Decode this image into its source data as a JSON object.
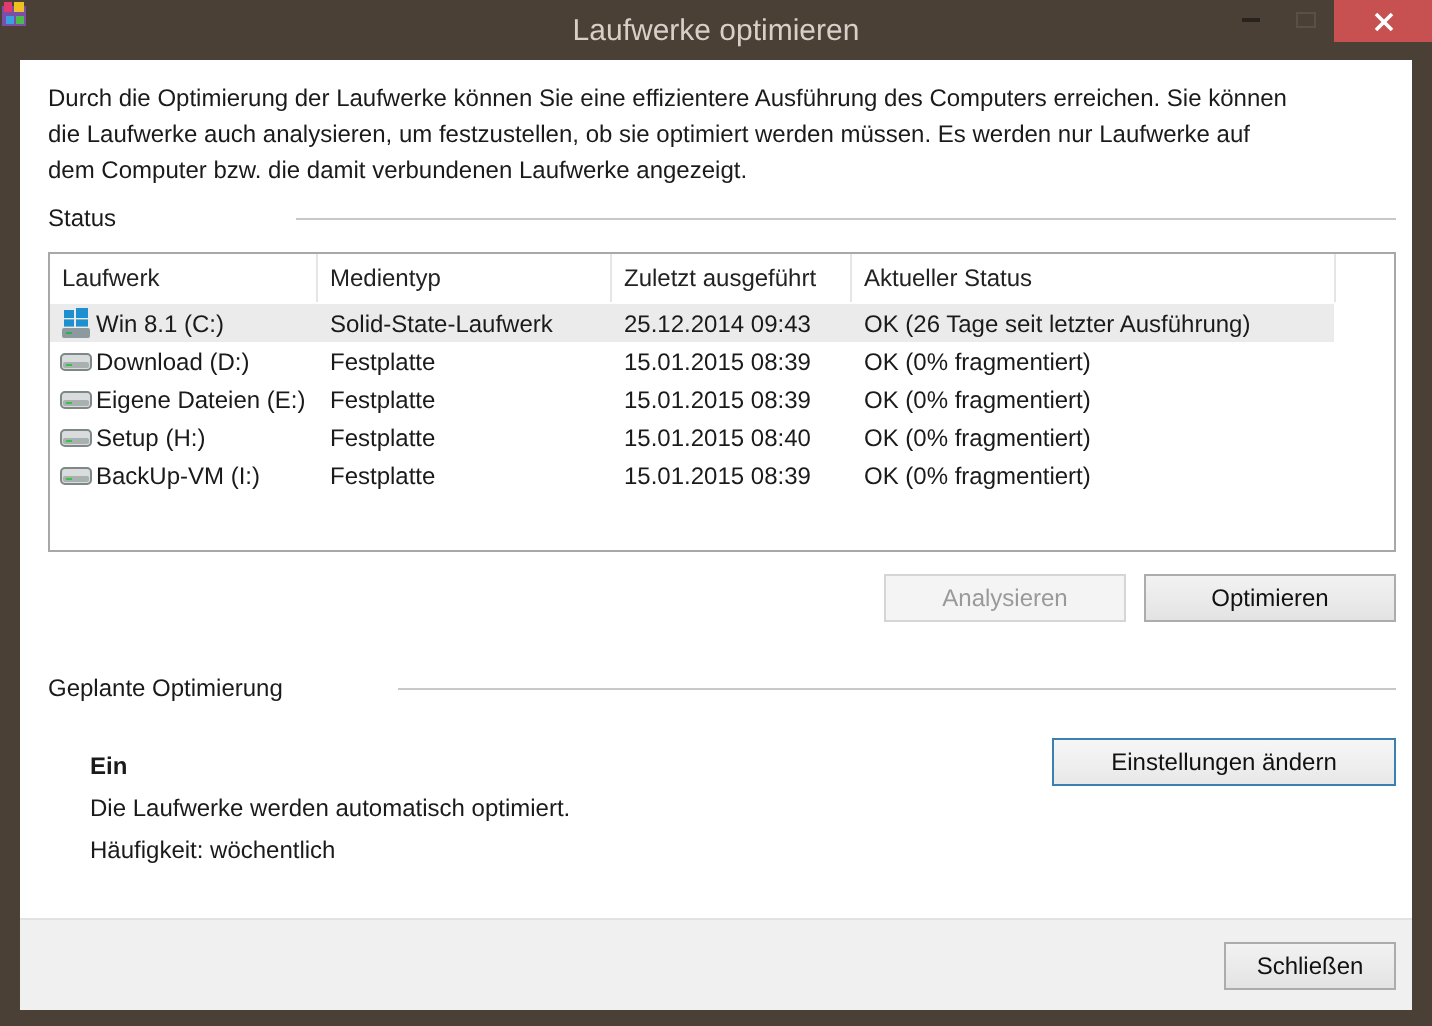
{
  "window": {
    "title": "Laufwerke optimieren"
  },
  "description": "Durch die Optimierung der Laufwerke können Sie eine effizientere Ausführung des Computers erreichen. Sie können die Laufwerke auch analysieren, um festzustellen, ob sie optimiert werden müssen. Es werden nur Laufwerke auf dem Computer bzw. die damit verbundenen Laufwerke angezeigt.",
  "status": {
    "heading": "Status",
    "table": {
      "columns": [
        "Laufwerk",
        "Medientyp",
        "Zuletzt ausgeführt",
        "Aktueller Status"
      ],
      "rows": [
        {
          "kind": "ssd",
          "selected": true,
          "cells": [
            "Win 8.1 (C:)",
            "Solid-State-Laufwerk",
            "25.12.2014 09:43",
            "OK (26 Tage seit letzter Ausführung)"
          ]
        },
        {
          "kind": "hdd",
          "selected": false,
          "cells": [
            "Download (D:)",
            "Festplatte",
            "15.01.2015 08:39",
            "OK (0% fragmentiert)"
          ]
        },
        {
          "kind": "hdd",
          "selected": false,
          "cells": [
            "Eigene Dateien (E:)",
            "Festplatte",
            "15.01.2015 08:39",
            "OK (0% fragmentiert)"
          ]
        },
        {
          "kind": "hdd",
          "selected": false,
          "cells": [
            "Setup (H:)",
            "Festplatte",
            "15.01.2015 08:40",
            "OK (0% fragmentiert)"
          ]
        },
        {
          "kind": "hdd",
          "selected": false,
          "cells": [
            "BackUp-VM (I:)",
            "Festplatte",
            "15.01.2015 08:39",
            "OK (0% fragmentiert)"
          ]
        }
      ]
    }
  },
  "buttons": [
    {
      "label": "Analysieren",
      "disabled": true
    },
    {
      "label": "Optimieren",
      "disabled": false
    }
  ],
  "schedule": {
    "heading": "Geplante Optimierung",
    "state": "Ein",
    "description": "Die Laufwerke werden automatisch optimiert.",
    "frequency": "Häufigkeit: wöchentlich",
    "button": {
      "label": "Einstellungen ändern",
      "focused": true
    }
  },
  "footer": {
    "close_button": "Schließen"
  }
}
